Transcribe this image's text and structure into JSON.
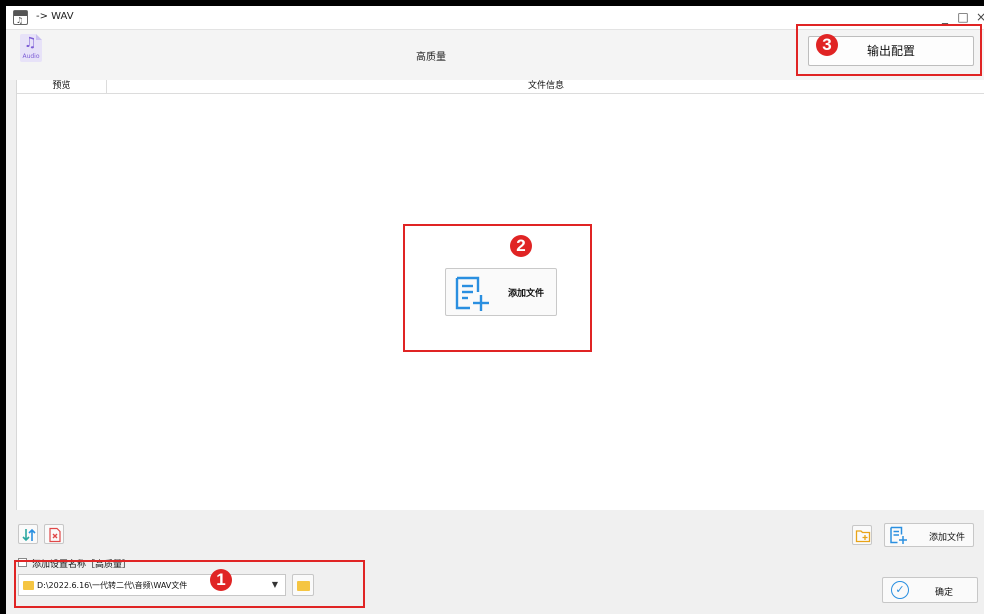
{
  "window": {
    "title": "-> WAV",
    "app_icon_text": "♫",
    "minimize_icon": "minimize-icon",
    "maximize_icon": "maximize-icon",
    "close_icon": "close-icon"
  },
  "header": {
    "audio_icon_note": "♫",
    "audio_icon_text": "Audio",
    "preset_title": "高质量",
    "output_config_label": "输出配置"
  },
  "list": {
    "columns": [
      "预览",
      "文件信息"
    ],
    "add_file_label": "添加文件"
  },
  "toolbar": {
    "add_file_label": "添加文件",
    "checkbox_label": "添加设置名称［高质量］",
    "checkbox_checked": false,
    "output_path": "D:\\2022.6.16\\一代转二代\\音频\\WAV文件",
    "confirm_label": "确定"
  },
  "annotations": {
    "badge_1": "1",
    "badge_2": "2",
    "badge_3": "3",
    "color": "#e02424"
  },
  "colors": {
    "accent_blue": "#2a8fe0",
    "folder_yellow": "#f5c542",
    "audio_purple": "#7c5cd6"
  }
}
